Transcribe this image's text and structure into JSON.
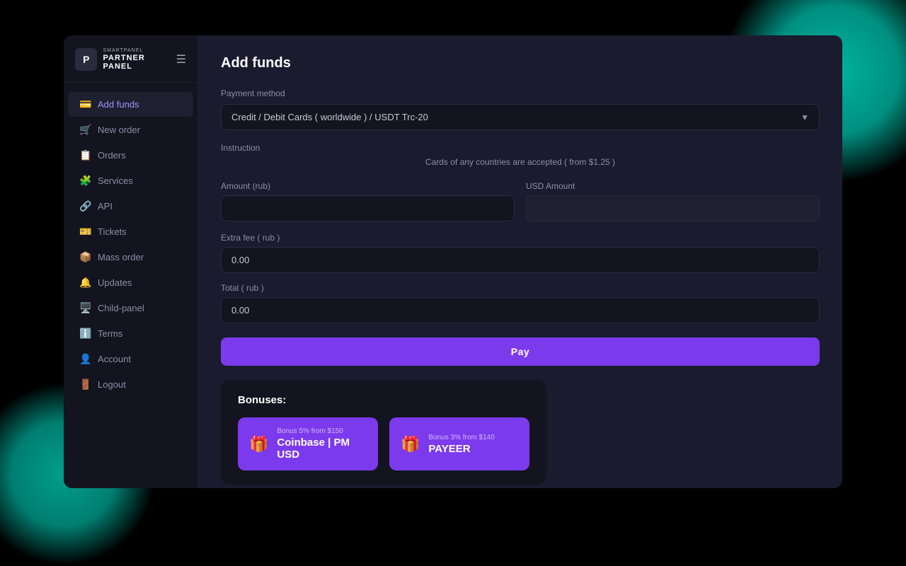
{
  "app": {
    "logo_small": "P",
    "logo_line1": "SMARTPANEL",
    "logo_line2": "PARTNER PANEL"
  },
  "sidebar": {
    "items": [
      {
        "id": "add-funds",
        "label": "Add funds",
        "icon": "💳",
        "active": true
      },
      {
        "id": "new-order",
        "label": "New order",
        "icon": "🛒",
        "active": false
      },
      {
        "id": "orders",
        "label": "Orders",
        "icon": "📋",
        "active": false
      },
      {
        "id": "services",
        "label": "Services",
        "icon": "🧩",
        "active": false
      },
      {
        "id": "api",
        "label": "API",
        "icon": "🔗",
        "active": false
      },
      {
        "id": "tickets",
        "label": "Tickets",
        "icon": "🎫",
        "active": false
      },
      {
        "id": "mass-order",
        "label": "Mass order",
        "icon": "📦",
        "active": false
      },
      {
        "id": "updates",
        "label": "Updates",
        "icon": "🔔",
        "active": false
      },
      {
        "id": "child-panel",
        "label": "Child-panel",
        "icon": "🖥️",
        "active": false
      },
      {
        "id": "terms",
        "label": "Terms",
        "icon": "ℹ️",
        "active": false
      },
      {
        "id": "account",
        "label": "Account",
        "icon": "👤",
        "active": false
      },
      {
        "id": "logout",
        "label": "Logout",
        "icon": "🚪",
        "active": false
      }
    ]
  },
  "page": {
    "title": "Add funds"
  },
  "form": {
    "payment_method_label": "Payment method",
    "payment_method_value": "Credit / Debit Cards ( worldwide ) / USDT Trc-20",
    "instruction_label": "Instruction",
    "instruction_text": "Cards of any countries are accepted ( from $1.25 )",
    "amount_rub_label": "Amount (rub)",
    "amount_rub_value": "",
    "usd_amount_label": "USD Amount",
    "usd_amount_value": "",
    "extra_fee_label": "Extra fee ( rub )",
    "extra_fee_value": "0.00",
    "total_label": "Total ( rub )",
    "total_value": "0.00",
    "pay_button": "Pay"
  },
  "bonuses": {
    "title": "Bonuses:",
    "cards": [
      {
        "sub": "Bonus 5% from $150",
        "name": "Coinbase | PM USD",
        "icon": "🎁"
      },
      {
        "sub": "Bonus 3% from $140",
        "name": "PAYEER",
        "icon": "🎁"
      }
    ]
  }
}
